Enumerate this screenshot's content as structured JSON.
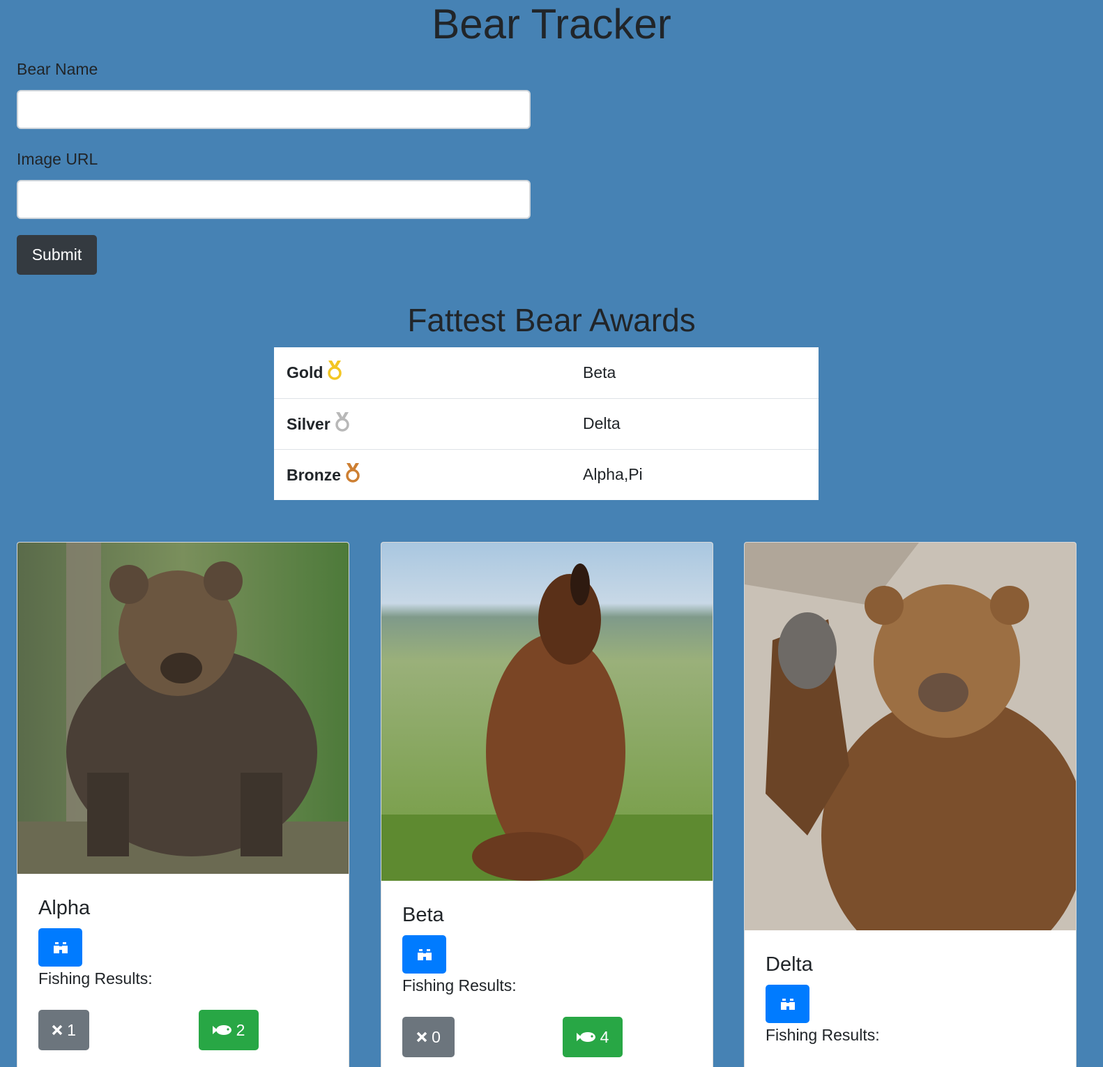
{
  "header": {
    "title": "Bear Tracker"
  },
  "form": {
    "bear_name_label": "Bear Name",
    "bear_name_value": "",
    "image_url_label": "Image URL",
    "image_url_value": "",
    "submit_label": "Submit"
  },
  "awards": {
    "title": "Fattest Bear Awards",
    "rows": [
      {
        "place": "Gold",
        "medal": "gold-medal-icon",
        "color": "#f3c623",
        "winner": "Beta"
      },
      {
        "place": "Silver",
        "medal": "silver-medal-icon",
        "color": "#b8b8b8",
        "winner": "Delta"
      },
      {
        "place": "Bronze",
        "medal": "bronze-medal-icon",
        "color": "#cd7f32",
        "winner": "Alpha,Pi"
      }
    ]
  },
  "bears": [
    {
      "name": "Alpha",
      "fishing_label": "Fishing Results:",
      "misses": "1",
      "catches": "2"
    },
    {
      "name": "Beta",
      "fishing_label": "Fishing Results:",
      "misses": "0",
      "catches": "4"
    },
    {
      "name": "Delta",
      "fishing_label": "Fishing Results:",
      "misses": "",
      "catches": ""
    }
  ],
  "icons": {
    "watch": "binoculars-icon",
    "miss": "times-icon",
    "catch": "fish-icon"
  },
  "colors": {
    "background": "#4682b4",
    "primary": "#007bff",
    "success": "#28a745",
    "secondary": "#6c757d",
    "dark": "#343a40"
  }
}
